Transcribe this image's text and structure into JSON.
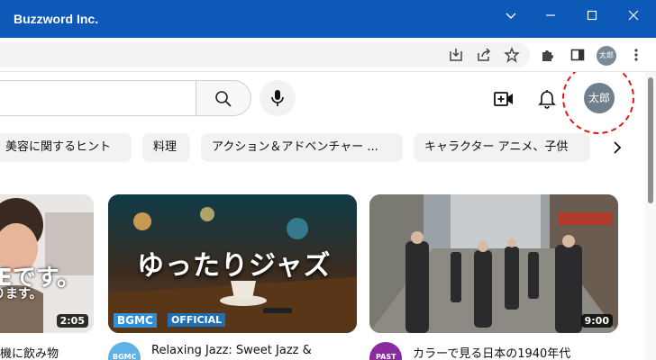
{
  "window": {
    "title": "Buzzword Inc."
  },
  "browser": {
    "profile_label": "太郎"
  },
  "header": {
    "avatar_label": "太郎"
  },
  "chips": [
    "美容に関するヒント",
    "料理",
    "アクション＆アドベンチャー ...",
    "キャラクター アニメ、子供"
  ],
  "videos": [
    {
      "thumb_text_line1": "Eです。",
      "thumb_text_line2": "ります。",
      "duration": "2:05",
      "title": "機に飲み物"
    },
    {
      "thumb_text": "ゆったりジャズ",
      "badge_left": "BGMC",
      "badge_right": "OFFICIAL",
      "duration": "",
      "title": "Relaxing Jazz: Sweet Jazz &",
      "channel_initials": "BGMC"
    },
    {
      "duration": "9:00",
      "title": "カラーで見る日本の1940年代",
      "channel_initials": "PAST"
    }
  ],
  "colors": {
    "titlebar": "#0c59b8",
    "annotation": "#e11111",
    "chip_bg": "#f2f2f2",
    "jazz_badge": "#2f8fd8"
  },
  "icons": [
    "minimize-icon",
    "maximize-icon",
    "close-icon",
    "install-icon",
    "share-icon",
    "star-icon",
    "extensions-icon",
    "sidepanel-icon",
    "more-icon",
    "search-icon",
    "mic-icon",
    "create-video-icon",
    "bell-icon",
    "chevron-right-icon"
  ]
}
